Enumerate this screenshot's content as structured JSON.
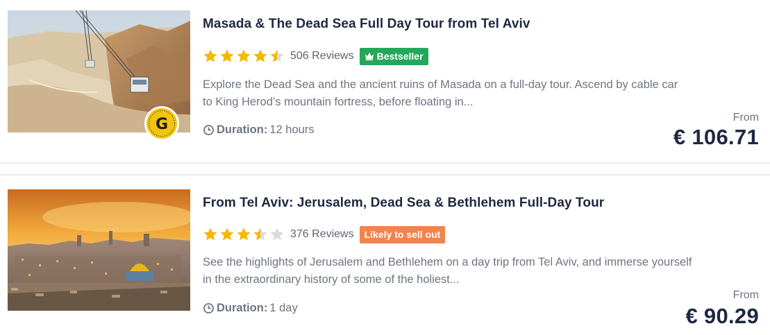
{
  "tours": [
    {
      "title": "Masada & The Dead Sea Full Day Tour from Tel Aviv",
      "rating": 4.5,
      "reviews": "506 Reviews",
      "badge": "Bestseller",
      "description_line1": "Explore the Dead Sea and the ancient ruins of Masada on a full-day tour. Ascend by cable car",
      "description_line2": "to King Herod’s mountain fortress, before floating in...",
      "duration_label": "Duration:",
      "duration_value": "12 hours",
      "from_label": "From",
      "price": "€ 106.71",
      "image_icon": "cable-car-desert-photo",
      "colors": {
        "badge": "#23a85a"
      }
    },
    {
      "title": "From Tel Aviv: Jerusalem, Dead Sea & Bethlehem Full-Day Tour",
      "rating": 3.5,
      "reviews": "376 Reviews",
      "badge": "Likely to sell out",
      "description_line1": "See the highlights of Jerusalem and Bethlehem on a day trip from Tel Aviv, and immerse yourself",
      "description_line2": "in the extraordinary history of some of the holiest...",
      "duration_label": "Duration:",
      "duration_value": "1 day",
      "from_label": "From",
      "price": "€ 90.29",
      "image_icon": "jerusalem-sunset-photo",
      "colors": {
        "badge": "#f1844a"
      }
    }
  ],
  "colors": {
    "star": "#f5b800",
    "star_empty": "#d8dbe0",
    "title": "#1e2742",
    "text": "#6e7482"
  }
}
